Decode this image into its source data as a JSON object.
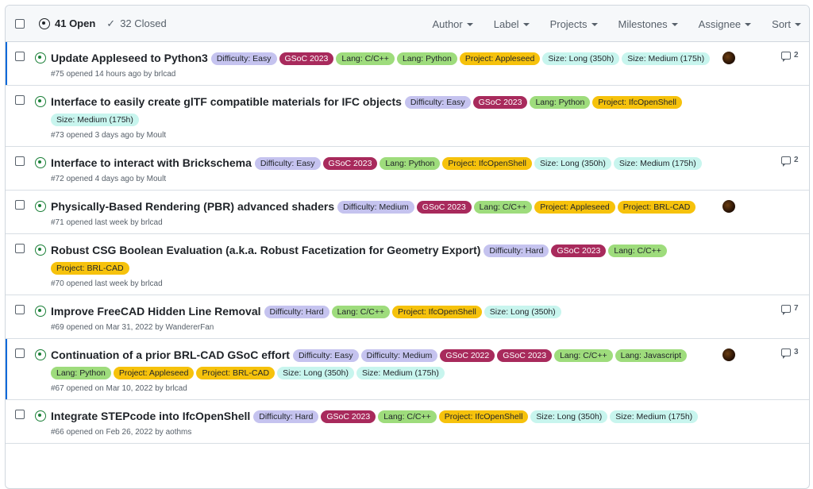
{
  "header": {
    "open_count": "41 Open",
    "closed_count": "32 Closed",
    "filters": [
      "Author",
      "Label",
      "Projects",
      "Milestones",
      "Assignee",
      "Sort"
    ]
  },
  "label_colors": {
    "Difficulty: Easy": {
      "bg": "#c5c3ef",
      "fg": "#1f2328"
    },
    "Difficulty: Medium": {
      "bg": "#c5c3ef",
      "fg": "#1f2328"
    },
    "Difficulty: Hard": {
      "bg": "#c5c3ef",
      "fg": "#1f2328"
    },
    "GSoC 2023": {
      "bg": "#a82a5c",
      "fg": "#ffffff"
    },
    "GSoC 2022": {
      "bg": "#a82a5c",
      "fg": "#ffffff"
    },
    "Lang: C/C++": {
      "bg": "#9edc7c",
      "fg": "#1f2328"
    },
    "Lang: Python": {
      "bg": "#9edc7c",
      "fg": "#1f2328"
    },
    "Lang: Javascript": {
      "bg": "#9edc7c",
      "fg": "#1f2328"
    },
    "Project: Appleseed": {
      "bg": "#f6c20c",
      "fg": "#1f2328"
    },
    "Project: IfcOpenShell": {
      "bg": "#f6c20c",
      "fg": "#1f2328"
    },
    "Project: BRL-CAD": {
      "bg": "#f6c20c",
      "fg": "#1f2328"
    },
    "Size: Long (350h)": {
      "bg": "#c8f5ee",
      "fg": "#1f2328"
    },
    "Size: Medium (175h)": {
      "bg": "#c8f5ee",
      "fg": "#1f2328"
    }
  },
  "issues": [
    {
      "title": "Update Appleseed to Python3",
      "labels": [
        "Difficulty: Easy",
        "GSoC 2023",
        "Lang: C/C++",
        "Lang: Python",
        "Project: Appleseed",
        "Size: Long (350h)",
        "Size: Medium (175h)"
      ],
      "meta": "#75 opened 14 hours ago by brlcad",
      "has_avatar": true,
      "comments": "2",
      "active": true
    },
    {
      "title": "Interface to easily create glTF compatible materials for IFC objects",
      "labels": [
        "Difficulty: Easy",
        "GSoC 2023",
        "Lang: Python",
        "Project: IfcOpenShell",
        "Size: Medium (175h)"
      ],
      "meta": "#73 opened 3 days ago by Moult",
      "has_avatar": false,
      "comments": "",
      "active": false
    },
    {
      "title": "Interface to interact with Brickschema",
      "labels": [
        "Difficulty: Easy",
        "GSoC 2023",
        "Lang: Python",
        "Project: IfcOpenShell",
        "Size: Long (350h)",
        "Size: Medium (175h)"
      ],
      "meta": "#72 opened 4 days ago by Moult",
      "has_avatar": false,
      "comments": "2",
      "active": false
    },
    {
      "title": "Physically-Based Rendering (PBR) advanced shaders",
      "labels": [
        "Difficulty: Medium",
        "GSoC 2023",
        "Lang: C/C++",
        "Project: Appleseed",
        "Project: BRL-CAD"
      ],
      "meta": "#71 opened last week by brlcad",
      "has_avatar": true,
      "comments": "",
      "active": false
    },
    {
      "title": "Robust CSG Boolean Evaluation (a.k.a. Robust Facetization for Geometry Export)",
      "labels": [
        "Difficulty: Hard",
        "GSoC 2023",
        "Lang: C/C++",
        "Project: BRL-CAD"
      ],
      "meta": "#70 opened last week by brlcad",
      "has_avatar": false,
      "comments": "",
      "active": false
    },
    {
      "title": "Improve FreeCAD Hidden Line Removal",
      "labels": [
        "Difficulty: Hard",
        "Lang: C/C++",
        "Project: IfcOpenShell",
        "Size: Long (350h)"
      ],
      "meta": "#69 opened on Mar 31, 2022 by WandererFan",
      "has_avatar": false,
      "comments": "7",
      "active": false
    },
    {
      "title": "Continuation of a prior BRL-CAD GSoC effort",
      "labels": [
        "Difficulty: Easy",
        "Difficulty: Medium",
        "GSoC 2022",
        "GSoC 2023",
        "Lang: C/C++",
        "Lang: Javascript",
        "Lang: Python",
        "Project: Appleseed",
        "Project: BRL-CAD",
        "Size: Long (350h)",
        "Size: Medium (175h)"
      ],
      "meta": "#67 opened on Mar 10, 2022 by brlcad",
      "has_avatar": true,
      "comments": "3",
      "active": true
    },
    {
      "title": "Integrate STEPcode into IfcOpenShell",
      "labels": [
        "Difficulty: Hard",
        "GSoC 2023",
        "Lang: C/C++",
        "Project: IfcOpenShell",
        "Size: Long (350h)",
        "Size: Medium (175h)"
      ],
      "meta": "#66 opened on Feb 26, 2022 by aothms",
      "has_avatar": false,
      "comments": "",
      "active": false
    }
  ]
}
